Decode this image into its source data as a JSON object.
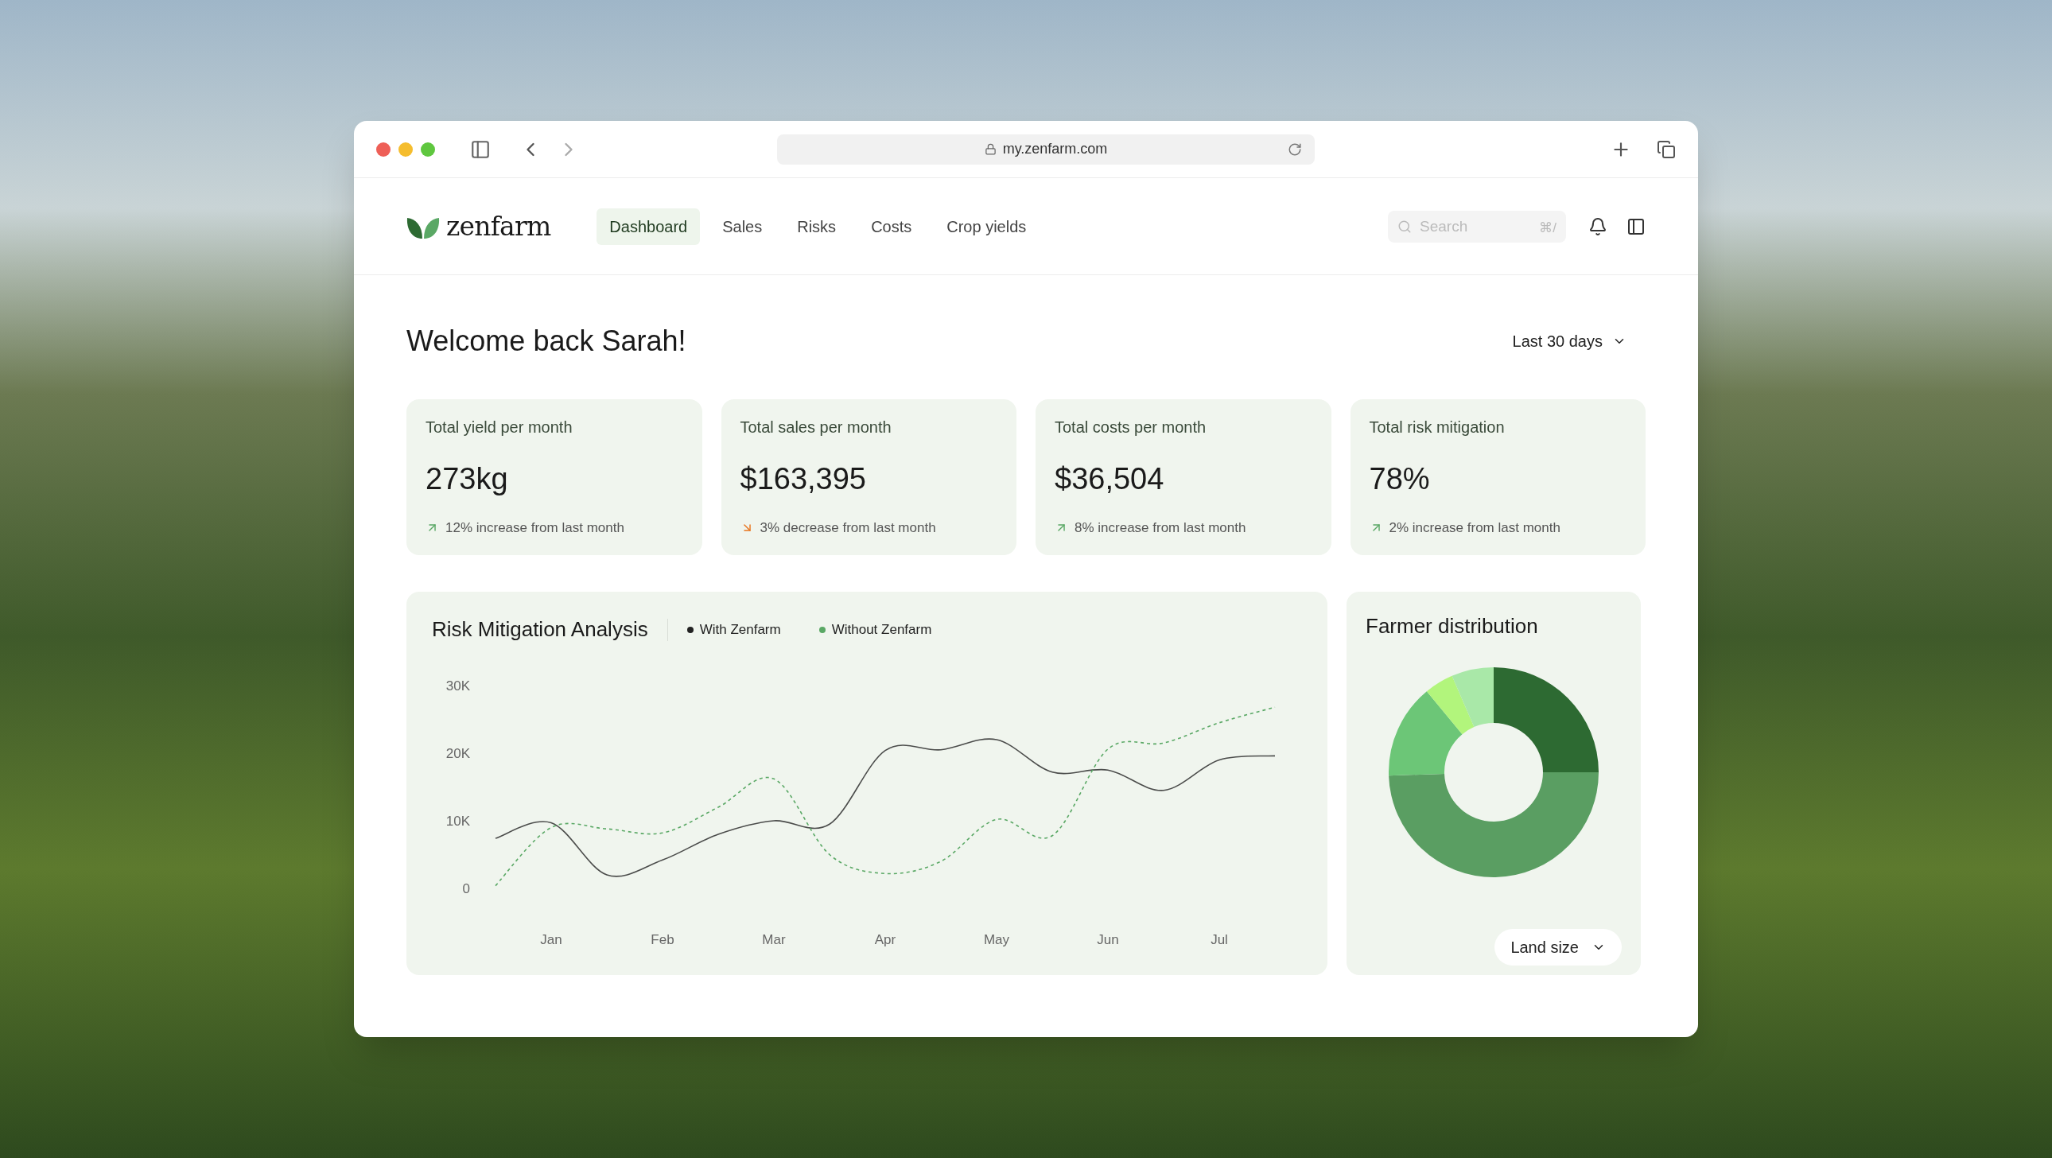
{
  "browser": {
    "url": "my.zenfarm.com"
  },
  "nav": {
    "logo": "zenfarm",
    "tabs": [
      {
        "label": "Dashboard",
        "selected": true
      },
      {
        "label": "Sales",
        "selected": false
      },
      {
        "label": "Risks",
        "selected": false
      },
      {
        "label": "Costs",
        "selected": false
      },
      {
        "label": "Crop yields",
        "selected": false
      }
    ],
    "search": {
      "placeholder": "Search",
      "shortcut": "⌘/"
    }
  },
  "greeting": "Welcome back Sarah!",
  "period": "Last 30 days",
  "stats": [
    {
      "label": "Total yield per month",
      "value": "273kg",
      "change": "12% increase from last month",
      "kind": "increase"
    },
    {
      "label": "Total sales per month",
      "value": "$163,395",
      "change": "3% decrease from last month",
      "kind": "decrease"
    },
    {
      "label": "Total costs per month",
      "value": "$36,504",
      "change": "8% increase from last month",
      "kind": "increase"
    },
    {
      "label": "Total risk mitigation",
      "value": "78%",
      "change": "2% increase from last month",
      "kind": "increase"
    }
  ],
  "risk_chart": {
    "title": "Risk Mitigation Analysis",
    "chart_data": {
      "type": "line",
      "categories": [
        null,
        "Jan",
        null,
        "Feb",
        null,
        "Mar",
        null,
        "Apr",
        null,
        "May",
        null,
        "Jun",
        null,
        "Jul",
        null
      ],
      "series": [
        {
          "name": "With Zenfarm",
          "color": "#222222",
          "line_style": "solid",
          "values": [
            7400,
            9700,
            2000,
            4200,
            8000,
            10000,
            9500,
            20400,
            20500,
            22000,
            17200,
            17500,
            14500,
            19000,
            19600
          ]
        },
        {
          "name": "Without Zenfarm",
          "color": "#5aa865",
          "line_style": "dashed",
          "values": [
            400,
            9000,
            8800,
            8200,
            12000,
            16200,
            5000,
            2200,
            4000,
            10200,
            7800,
            20600,
            21500,
            24500,
            26800
          ]
        }
      ],
      "ylim": [
        0,
        30000
      ],
      "yticks": [
        {
          "value": 0,
          "label": "0"
        },
        {
          "value": 10000,
          "label": "10K"
        },
        {
          "value": 20000,
          "label": "20K"
        },
        {
          "value": 30000,
          "label": "30K"
        }
      ]
    }
  },
  "distribution": {
    "title": "Farmer distribution",
    "filter": "Land size"
  }
}
